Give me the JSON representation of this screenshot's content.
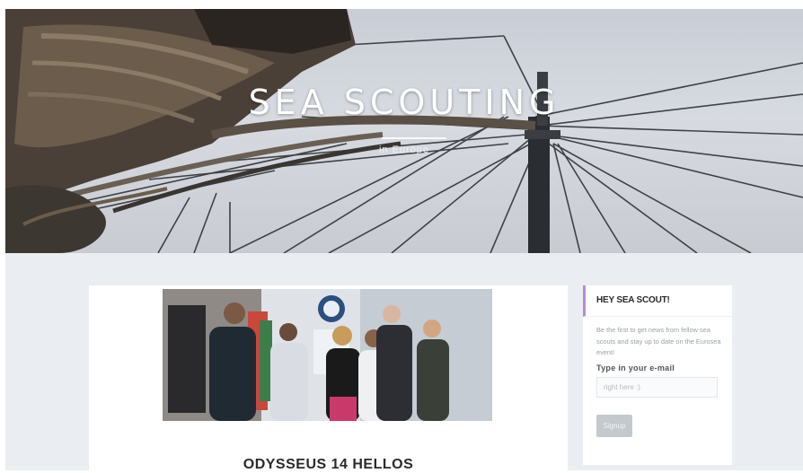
{
  "site": {
    "title": "SEA SCOUTING",
    "tagline": "in Europe"
  },
  "post": {
    "title": "ODYSSEUS 14 HELLOS",
    "image_alt": "Group of sea scouts standing in a row at an event"
  },
  "widget": {
    "title": "HEY SEA SCOUT!",
    "description": "Be the first to get news from fellow sea scouts and stay up to date on the Eurosea event!",
    "email_label": "Type in your e-mail",
    "email_placeholder": "right here :)",
    "email_value": "",
    "signup_label": "Signup"
  },
  "colors": {
    "widget_accent": "#b98ad6",
    "content_background": "#eaedf1",
    "signup_button": "#c4c9ce"
  },
  "icons": {
    "hero_image": "ship-rigging-photo",
    "post_image": "group-photo"
  }
}
